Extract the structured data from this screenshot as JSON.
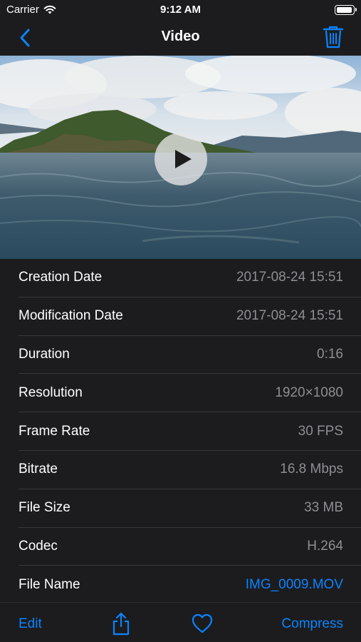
{
  "status_bar": {
    "carrier": "Carrier",
    "time": "9:12 AM",
    "battery_level": 0.95
  },
  "nav": {
    "title": "Video"
  },
  "details": [
    {
      "label": "Creation Date",
      "value": "2017-08-24  15:51"
    },
    {
      "label": "Modification Date",
      "value": "2017-08-24  15:51"
    },
    {
      "label": "Duration",
      "value": "0:16"
    },
    {
      "label": "Resolution",
      "value": "1920×1080"
    },
    {
      "label": "Frame Rate",
      "value": "30 FPS"
    },
    {
      "label": "Bitrate",
      "value": "16.8 Mbps"
    },
    {
      "label": "File Size",
      "value": "33 MB"
    },
    {
      "label": "Codec",
      "value": "H.264"
    },
    {
      "label": "File Name",
      "value": "IMG_0009.MOV"
    }
  ],
  "toolbar": {
    "edit_label": "Edit",
    "compress_label": "Compress"
  },
  "icons": {
    "back": "chevron-left-icon",
    "trash": "trash-icon",
    "play": "play-icon",
    "share": "share-icon",
    "favorite": "heart-icon",
    "wifi": "wifi-icon",
    "battery": "battery-icon"
  },
  "colors": {
    "accent": "#0a84ff",
    "background": "#1c1c1e",
    "secondary_text": "#8e8e93"
  }
}
